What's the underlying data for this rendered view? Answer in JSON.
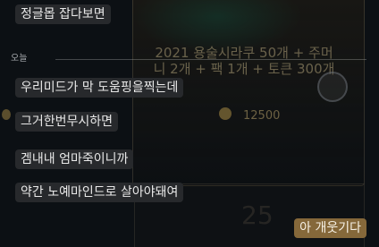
{
  "background": {
    "card_title": "2021 용술시라쿠 50개 + 주머니 2개 + 팩 1개 + 토큰 300개",
    "price": "12500",
    "big_number": "25"
  },
  "chat": {
    "date_divider": "오늘",
    "messages": [
      {
        "text": "정글몹 잡다보면",
        "sender": "other"
      },
      {
        "text": "우리미드가 막 도움핑을찍는데",
        "sender": "other"
      },
      {
        "text": "그거한번무시하면",
        "sender": "other"
      },
      {
        "text": "겜내내 엄마죽이니까",
        "sender": "other"
      },
      {
        "text": "약간 노예마인드로 살아야돼여",
        "sender": "other"
      },
      {
        "text": "아 개웃기다",
        "sender": "me"
      }
    ]
  },
  "colors": {
    "background": "#0c1014",
    "other_bubble": "#27292c",
    "my_bubble": "#85683a"
  }
}
